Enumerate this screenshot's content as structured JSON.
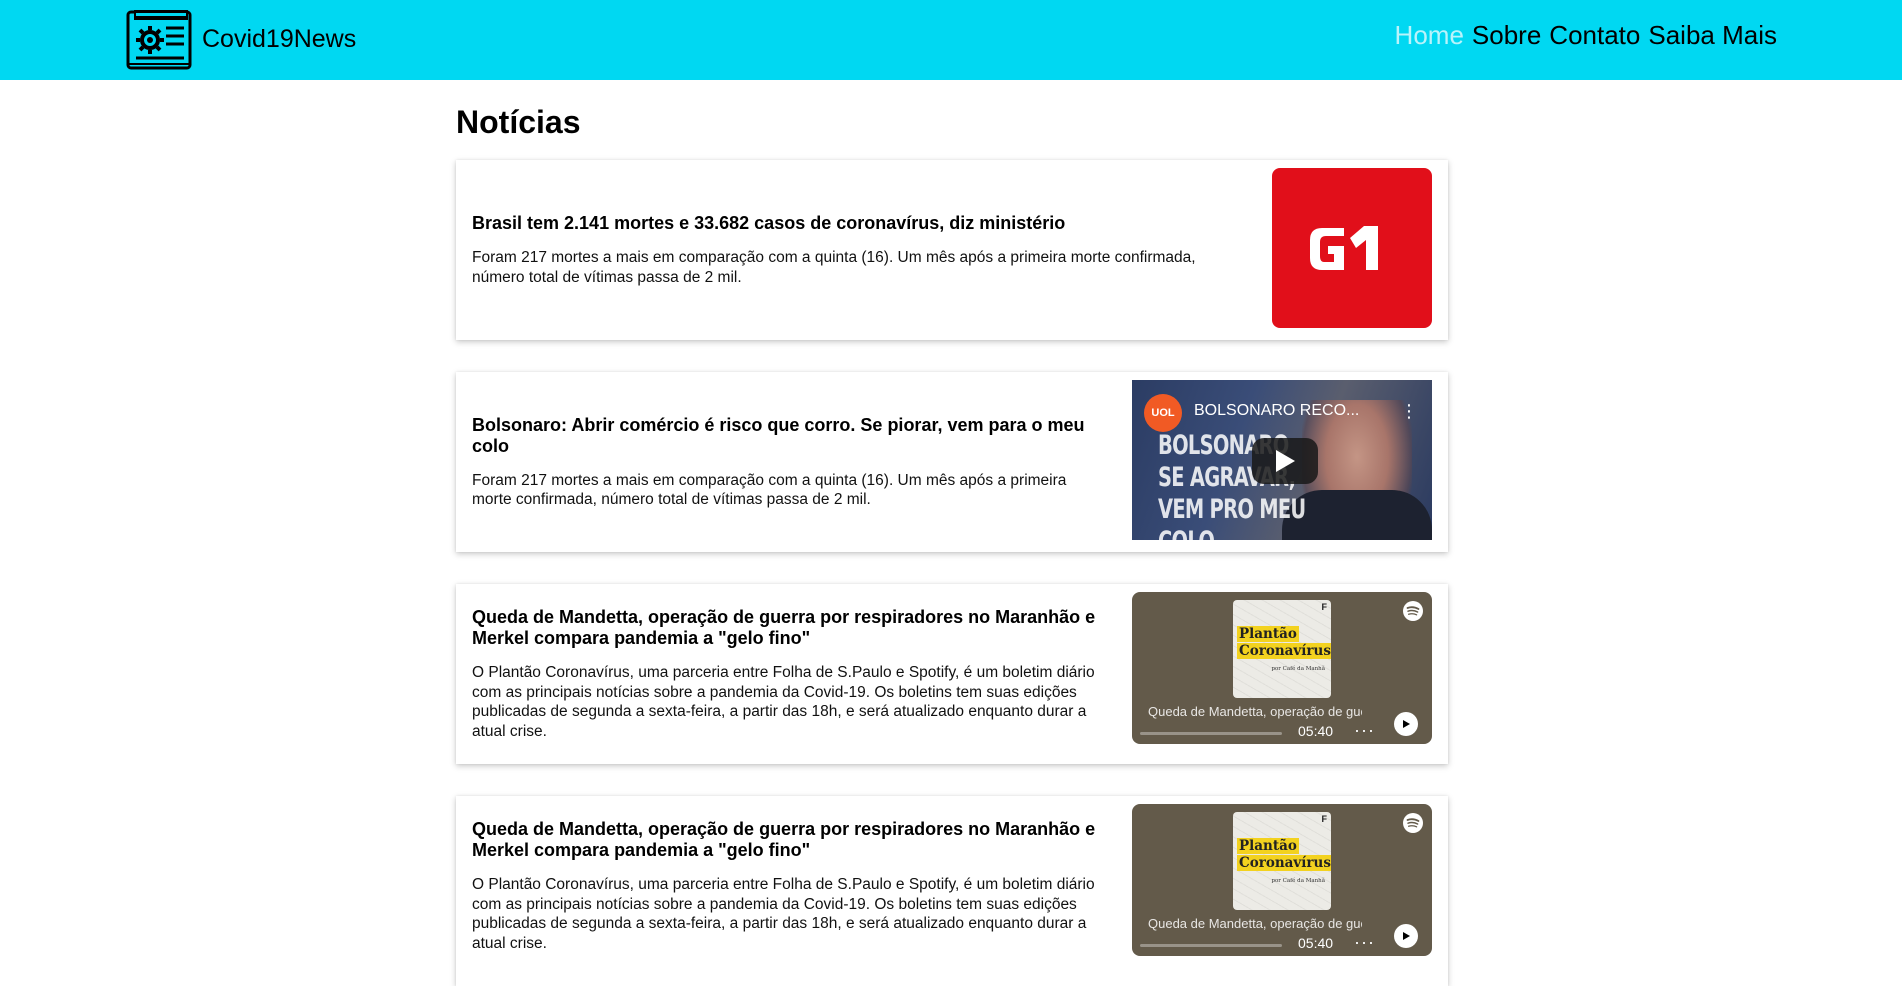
{
  "header": {
    "brand": "Covid19News",
    "nav": [
      {
        "label": "Home",
        "active": true
      },
      {
        "label": "Sobre",
        "active": false
      },
      {
        "label": "Contato",
        "active": false
      },
      {
        "label": "Saiba Mais",
        "active": false
      }
    ]
  },
  "colors": {
    "header_bg": "#00d8f2",
    "nav_active": "#b9f3fb",
    "g1_red": "#e10f1a",
    "spotify_bg": "#635a4a"
  },
  "page": {
    "title": "Notícias"
  },
  "articles": [
    {
      "title": "Brasil tem 2.141 mortes e 33.682 casos de coronavírus, diz ministério",
      "text": "Foram 217 mortes a mais em comparação com a quinta (16). Um mês após a primeira morte confirmada, número total de vítimas passa de 2 mil.",
      "media": {
        "type": "image",
        "logo": "G1"
      }
    },
    {
      "title": "Bolsonaro: Abrir comércio é risco que corro. Se piorar, vem para o meu colo",
      "text": "Foram 217 mortes a mais em comparação com a quinta (16). Um mês após a primeira morte confirmada, número total de vítimas passa de 2 mil.",
      "media": {
        "type": "video",
        "channel": "UOL",
        "title": "BOLSONARO RECO...",
        "thumb_text": [
          "BOLSONARO",
          "SE AGRAVAR,",
          "VEM PRO MEU COLO"
        ]
      }
    },
    {
      "title": "Queda de Mandetta, operação de guerra por respiradores no Maranhão e Merkel compara pandemia a \"gelo fino\"",
      "text": "O Plantão Coronavírus, uma parceria entre Folha de S.Paulo e Spotify, é um boletim diário com as principais notícias sobre a pandemia da Covid-19. Os boletins tem suas edições publicadas de segunda a sexta-feira, a partir das 18h, e será atualizado enquanto durar a atual crise.",
      "media": {
        "type": "podcast",
        "cover_line1": "Plantão",
        "cover_line2": "Coronavírus",
        "cover_sub": "por Café da Manhã",
        "track": "Queda de Mandetta, operação de guerra",
        "duration": "05:40",
        "icon": "spotify-icon"
      }
    },
    {
      "title": "Queda de Mandetta, operação de guerra por respiradores no Maranhão e Merkel compara pandemia a \"gelo fino\"",
      "text": "O Plantão Coronavírus, uma parceria entre Folha de S.Paulo e Spotify, é um boletim diário com as principais notícias sobre a pandemia da Covid-19. Os boletins tem suas edições publicadas de segunda a sexta-feira, a partir das 18h, e será atualizado enquanto durar a atual crise.",
      "media": {
        "type": "podcast",
        "cover_line1": "Plantão",
        "cover_line2": "Coronavírus",
        "cover_sub": "por Café da Manhã",
        "track": "Queda de Mandetta, operação de guerra",
        "duration": "05:40",
        "icon": "spotify-icon"
      }
    }
  ]
}
